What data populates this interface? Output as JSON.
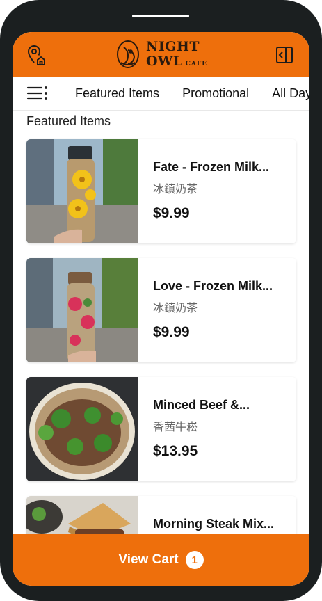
{
  "colors": {
    "accent": "#ee6f0c",
    "frame": "#1b1f20"
  },
  "header": {
    "logo_line1": "NIGHT",
    "logo_line2": "OWL",
    "logo_cafe": "CAFE",
    "left_icon": "store-location-icon",
    "right_icon": "collapse-panel-icon"
  },
  "categories": {
    "menu_icon": "menu-icon",
    "tabs": [
      {
        "label": "Featured Items"
      },
      {
        "label": "Promotional"
      },
      {
        "label": "All Day"
      }
    ]
  },
  "section": {
    "title": "Featured Items"
  },
  "items": [
    {
      "name": "Fate - Frozen Milk...",
      "subtitle": "冰鎮奶茶",
      "price": "$9.99"
    },
    {
      "name": "Love - Frozen Milk...",
      "subtitle": "冰鎮奶茶",
      "price": "$9.99"
    },
    {
      "name": "Minced Beef &...",
      "subtitle": "香茜牛崧",
      "price": "$13.95"
    },
    {
      "name": "Morning Steak Mix...",
      "subtitle": "",
      "price": ""
    }
  ],
  "cart": {
    "label": "View Cart",
    "count": "1"
  }
}
